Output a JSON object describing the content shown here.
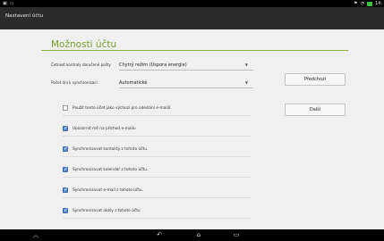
{
  "status_bar": {
    "left_icons": [
      "image-icon",
      "window-icon"
    ],
    "right_icons": [
      "notification-icon",
      "wifi-icon",
      "battery-icon"
    ],
    "clock": "14:"
  },
  "action_bar": {
    "title": "Nastavení účtu"
  },
  "page": {
    "heading": "Možnosti účtu",
    "settings": [
      {
        "label": "Četnost kontroly doručené pošty",
        "value": "Chytrý režim (Úspora energie)"
      },
      {
        "label": "Počet dní k synchronizaci",
        "value": "Automatické"
      }
    ],
    "buttons": {
      "previous": "Předchozí",
      "next": "Další"
    },
    "checkboxes": [
      {
        "label": "Použít tento účet jako výchozí pro odeslání e-mailů",
        "checked": false
      },
      {
        "label": "Upozornit mě na příchod e-mailu",
        "checked": true
      },
      {
        "label": "Synchronizovat kontakty z tohoto účtu.",
        "checked": true
      },
      {
        "label": "Synchronizovat kalendář z tohoto účtu.",
        "checked": true
      },
      {
        "label": "Synchronizovat e-mail z tohoto účtu.",
        "checked": true
      },
      {
        "label": "Synchronizovat úkoly z tohoto účtu",
        "checked": true
      }
    ]
  },
  "nav_bar": {
    "buttons": [
      "collapse-icon",
      "back-icon",
      "home-icon",
      "recent-apps-icon"
    ]
  },
  "colors": {
    "accent_green": "#8fb33a",
    "checkbox_blue": "#5d88c9",
    "action_bar": "#2b2b2b"
  }
}
